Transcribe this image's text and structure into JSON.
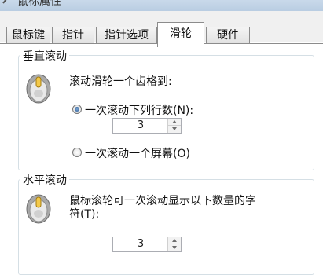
{
  "window": {
    "title": "鼠标属性"
  },
  "tabs": [
    {
      "label": "鼠标键"
    },
    {
      "label": "指针"
    },
    {
      "label": "指针选项"
    },
    {
      "label": "滑轮"
    },
    {
      "label": "硬件"
    }
  ],
  "active_tab": "滑轮",
  "vertical_group": {
    "label": "垂直滚动",
    "prompt": "滚动滑轮一个齿格到:",
    "option_lines_label": "一次滚动下列行数(N):",
    "option_lines_value": "3",
    "option_screen_label": "一次滚动一个屏幕(O)",
    "selected": "lines"
  },
  "horizontal_group": {
    "label": "水平滚动",
    "prompt_line1": "鼠标滚轮可一次滚动显示以下数量的字",
    "prompt_line2": "符(T):",
    "value": "3"
  },
  "icons": {
    "title_icon": "mouse-icon",
    "wheel_icon": "mouse-wheel-icon",
    "spin_up": "spin-up-arrow-icon",
    "spin_down": "spin-down-arrow-icon"
  },
  "colors": {
    "tab_border": "#8c8c8c",
    "group_border": "#d5dfe5",
    "radio_selected": "#1f4f8a"
  }
}
